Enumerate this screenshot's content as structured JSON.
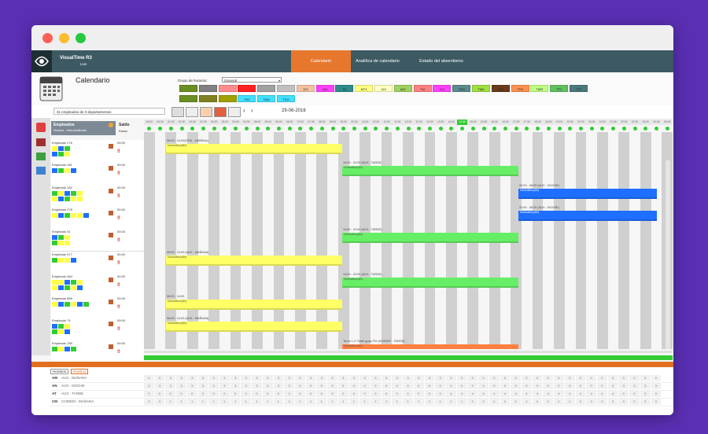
{
  "window": {
    "title": "VisualTime R3",
    "subtitle": "Live"
  },
  "nav": {
    "tabs": [
      {
        "label": "Calendario",
        "active": true
      },
      {
        "label": "Analítica de calendario",
        "active": false
      },
      {
        "label": "Estado del absentismo",
        "active": false
      }
    ]
  },
  "page": {
    "title": "Calendario"
  },
  "filter": {
    "group_label": "Grupo de horarios:",
    "group_value": "General"
  },
  "shift_chips_row1": [
    {
      "label": "",
      "color": "#6b8e23"
    },
    {
      "label": "",
      "color": "#808080"
    },
    {
      "label": "",
      "color": "#ff8c8c"
    },
    {
      "label": "",
      "color": "#ff2020"
    },
    {
      "label": "",
      "color": "#a0a0a0"
    },
    {
      "label": "",
      "color": "#c0c0c0"
    },
    {
      "label": "123",
      "color": "#f4c1a0"
    },
    {
      "label": "404",
      "color": "#ff40ff"
    },
    {
      "label": "IN",
      "color": "#2e8b8b"
    },
    {
      "label": "MT1",
      "color": "#ffff80"
    },
    {
      "label": "142",
      "color": "#ffffc0"
    },
    {
      "label": "842",
      "color": "#a0d060"
    },
    {
      "label": "TM",
      "color": "#ff8080"
    },
    {
      "label": "112",
      "color": "#ff40ff"
    },
    {
      "label": "TM3",
      "color": "#5a8a8a"
    },
    {
      "label": "TMK",
      "color": "#a0e040"
    },
    {
      "label": "TMC",
      "color": "#6b3a1a"
    },
    {
      "label": "TTN",
      "color": "#ff9050"
    },
    {
      "label": "TMR",
      "color": "#c0ff80"
    },
    {
      "label": "TT2",
      "color": "#60c060"
    },
    {
      "label": "TT3",
      "color": "#4a7a7a"
    }
  ],
  "shift_chips_row2": [
    {
      "label": "",
      "color": "#6b8e23"
    },
    {
      "label": "",
      "color": "#808020"
    },
    {
      "label": "",
      "color": "#a0a000"
    },
    {
      "label": "TSC",
      "color": "#40e0ff"
    },
    {
      "label": "TAM",
      "color": "#40e0ff"
    },
    {
      "label": "TSO",
      "color": "#40e0ff"
    }
  ],
  "toolbar": {
    "search_text": "31 empleados de 3 departamentos",
    "date": "29-06-2016"
  },
  "employee_header": {
    "title": "Empleados",
    "subtitle": "Horarios - Vista planificada",
    "balance_label": "Saldo",
    "status_label": "Estado"
  },
  "hours": [
    "00:00",
    "00:30",
    "01:00",
    "01:30",
    "02:00",
    "02:30",
    "03:00",
    "03:30",
    "04:00",
    "04:30",
    "05:00",
    "05:30",
    "06:00",
    "06:30",
    "07:00",
    "07:30",
    "08:00",
    "08:30",
    "09:00",
    "09:30",
    "10:00",
    "10:30",
    "11:00",
    "11:30",
    "12:00",
    "12:30",
    "13:00",
    "13:30",
    "14:00",
    "14:30",
    "15:00",
    "15:30",
    "16:00",
    "16:30",
    "17:00",
    "17:30",
    "18:00",
    "18:30",
    "19:00",
    "19:30",
    "20:00",
    "20:30",
    "21:00",
    "21:30",
    "22:00",
    "22:30",
    "23:00",
    "23:30",
    "00:00"
  ],
  "current_hour": "14:30",
  "employees": [
    {
      "name": "Empleado 176",
      "balance": "00:00"
    },
    {
      "name": "Empleado 181",
      "balance": "00:00"
    },
    {
      "name": "Empleado 182",
      "balance": "00:00"
    },
    {
      "name": "Empleado 278",
      "balance": "00:00"
    },
    {
      "name": "Empleado 31",
      "balance": "00:00"
    },
    {
      "name": "Empleado 477",
      "balance": "00:00"
    },
    {
      "name": "Empleado 484",
      "balance": "00:00"
    },
    {
      "name": "Empleado 589",
      "balance": "00:00"
    },
    {
      "name": "Empleado 74",
      "balance": "00:00"
    },
    {
      "name": "Empleado 789",
      "balance": "00:00"
    }
  ],
  "shifts": [
    {
      "row": 0,
      "start": 1.0,
      "end": 9.0,
      "color": "#ffff66",
      "time": "06:00 - 14:00(2016 - MAÑANA)",
      "label": "Normativo(8h)"
    },
    {
      "row": 1,
      "start": 9.0,
      "end": 17.0,
      "color": "#66ee66",
      "time": "14:00 - 22:00 (AUX - TARDE)",
      "label": "Normativo(8h)"
    },
    {
      "row": 2,
      "start": 17.0,
      "end": 23.3,
      "color": "#1e6fff",
      "time": "22:00 - 06:00 (AUX - NOCHE)",
      "label": "Normativo(8h)"
    },
    {
      "row": 3,
      "start": 17.0,
      "end": 23.3,
      "color": "#1e6fff",
      "time": "22:00 - 06:00 (AUX - NOCHE)",
      "label": "Normativo(8h)"
    },
    {
      "row": 4,
      "start": 9.0,
      "end": 17.0,
      "color": "#66ee66",
      "time": "14:00 - 22:00 (AUX - TARDE)",
      "label": "Normativo(8h)"
    },
    {
      "row": 5,
      "start": 1.0,
      "end": 9.0,
      "color": "#ffff66",
      "time": "06:00 - 14:00 (AUX - MAÑANA)",
      "label": "Normativo(8h)"
    },
    {
      "row": 6,
      "start": 9.0,
      "end": 17.0,
      "color": "#66ee66",
      "time": "14:00 - 22:00 (AUX - TARDE)",
      "label": "Normativo(8h)"
    },
    {
      "row": 7,
      "start": 1.0,
      "end": 9.0,
      "color": "#ffff66",
      "time": "06:00 - 14:00",
      "label": "Normativo(8h)"
    },
    {
      "row": 8,
      "start": 1.0,
      "end": 9.0,
      "color": "#ffff66",
      "time": "06:00 - 14:00 (AUX - MAÑANA)",
      "label": "Normativo(8h)"
    },
    {
      "row": 9,
      "start": 9.0,
      "end": 17.0,
      "color": "#ff8040",
      "time": "Turno L-V Tarde guay FIX (HORAVF - TARDE)",
      "label": "Normativo(8h)"
    }
  ],
  "bottom": {
    "tabs": [
      {
        "label": "Horarios",
        "active": true
      },
      {
        "label": "Puestos",
        "active": false
      }
    ],
    "rows": [
      {
        "code": "AM",
        "name": "AUX - MAÑANA",
        "values": [
          0,
          0,
          3,
          3,
          3,
          3,
          3,
          3,
          3,
          3,
          3,
          3,
          3,
          3,
          3,
          3,
          3,
          3,
          3,
          3,
          3,
          3,
          3,
          3,
          3,
          3,
          3,
          3,
          3,
          3,
          0,
          0,
          0,
          0,
          0,
          0,
          0,
          0,
          0,
          0,
          0,
          0,
          0,
          0,
          0,
          0,
          0,
          0
        ]
      },
      {
        "code": "AN",
        "name": "AUX - NOCHE",
        "values": [
          3,
          3,
          3,
          3,
          3,
          3,
          3,
          3,
          3,
          3,
          3,
          3,
          3,
          3,
          0,
          0,
          0,
          0,
          0,
          0,
          0,
          0,
          0,
          0,
          0,
          0,
          0,
          0,
          0,
          0,
          0,
          0,
          0,
          0,
          0,
          0,
          0,
          0,
          0,
          0,
          0,
          0,
          0,
          0,
          3,
          3,
          3,
          3
        ]
      },
      {
        "code": "AT",
        "name": "AUX - TARDE",
        "values": [
          0,
          0,
          0,
          0,
          0,
          0,
          0,
          0,
          0,
          0,
          0,
          0,
          0,
          0,
          0,
          0,
          0,
          0,
          0,
          0,
          0,
          0,
          0,
          0,
          0,
          0,
          0,
          0,
          4,
          4,
          4,
          4,
          4,
          4,
          4,
          4,
          4,
          4,
          4,
          4,
          4,
          4,
          4,
          4,
          0,
          0,
          0,
          0
        ]
      },
      {
        "code": "CM",
        "name": "COMEDI - MAÑANA",
        "values": [
          0,
          0,
          1,
          1,
          1,
          1,
          1,
          1,
          1,
          1,
          1,
          1,
          1,
          1,
          1,
          1,
          1,
          1,
          1,
          1,
          1,
          1,
          1,
          1,
          1,
          1,
          1,
          1,
          1,
          1,
          0,
          0,
          0,
          0,
          0,
          0,
          0,
          0,
          0,
          0,
          0,
          0,
          0,
          0,
          0,
          0,
          0,
          0
        ]
      }
    ]
  }
}
